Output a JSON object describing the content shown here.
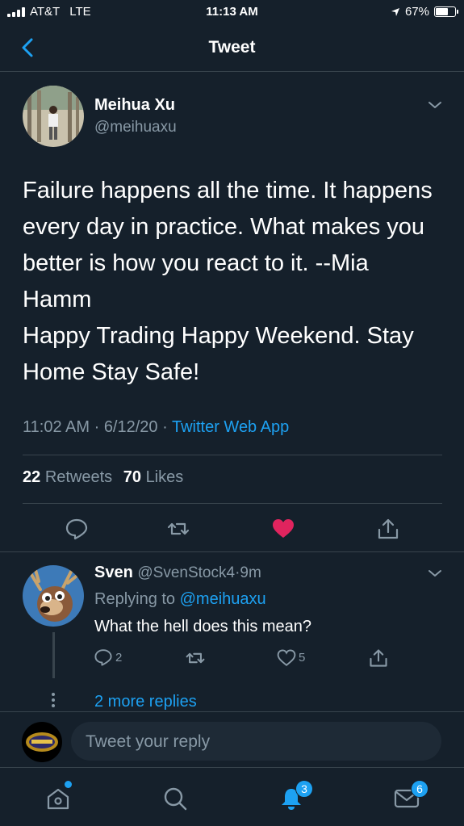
{
  "status_bar": {
    "carrier": "AT&T",
    "network": "LTE",
    "time": "11:13 AM",
    "battery": "67%",
    "battery_level": 0.67
  },
  "header": {
    "title": "Tweet"
  },
  "tweet": {
    "author_name": "Meihua Xu",
    "author_handle": "@meihuaxu",
    "text_lines": [
      "Failure happens all the time. It happens",
      "every day in practice. What makes you",
      "better is how you react to it. --Mia",
      "Hamm",
      "Happy Trading Happy Weekend. Stay",
      "Home Stay Safe!"
    ],
    "time": "11:02 AM",
    "date": "6/12/20",
    "source": "Twitter Web App",
    "retweets_count": "22",
    "retweets_label": "Retweets",
    "likes_count": "70",
    "likes_label": "Likes",
    "liked": true,
    "like_color": "#e0245e"
  },
  "reply": {
    "author_name": "Sven",
    "author_handle": "@SvenStock4",
    "age": "9m",
    "replying_to_label": "Replying to",
    "replying_to_handle": "@meihuaxu",
    "text": "What the hell does this mean?",
    "reply_count": "2",
    "like_count": "5",
    "more_replies": "2 more replies"
  },
  "compose": {
    "placeholder": "Tweet your reply"
  },
  "tabbar": {
    "notifications_badge": "3",
    "messages_badge": "6"
  },
  "colors": {
    "background": "#15202b",
    "accent": "#1da1f2",
    "secondary_text": "#8899a6",
    "divider": "#38444d"
  }
}
